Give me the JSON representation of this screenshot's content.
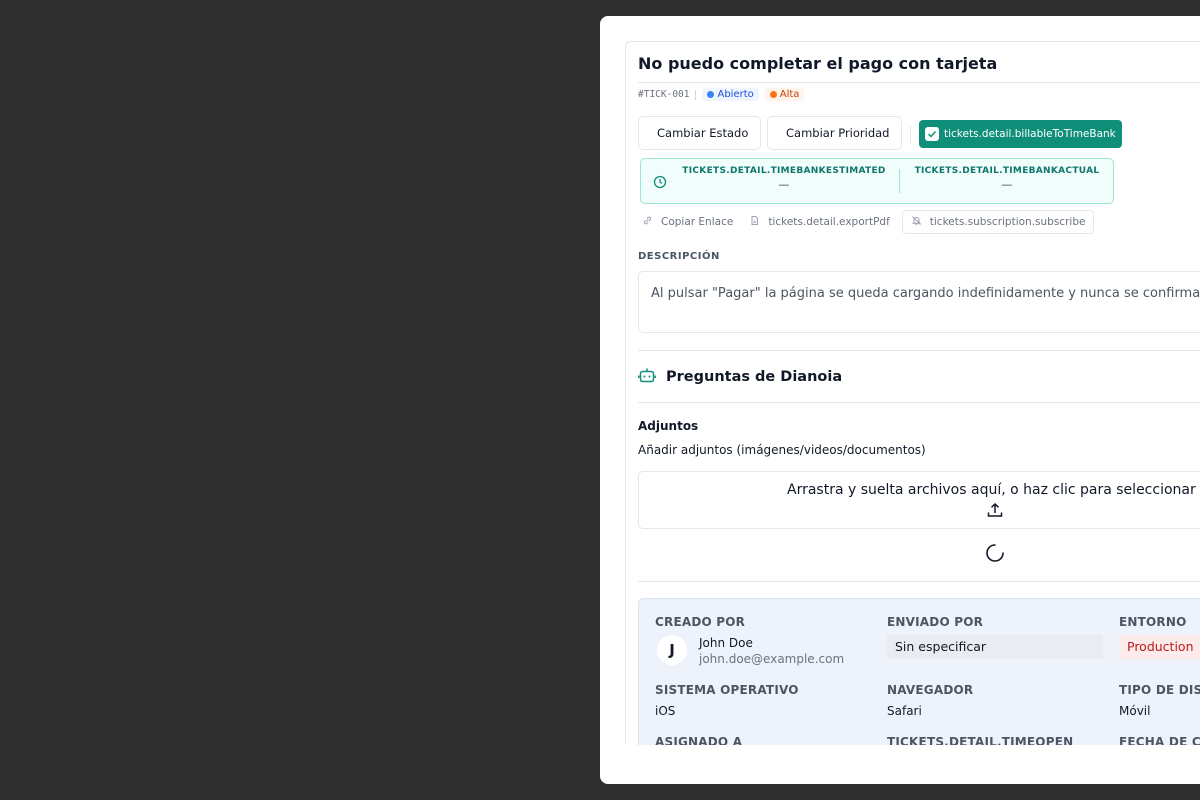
{
  "ticket": {
    "title": "No puedo completar el pago con tarjeta",
    "id": "#TICK-001",
    "status": "Abierto",
    "priority": "Alta"
  },
  "colors": {
    "status_dot": "#3b82f6",
    "priority_dot": "#f97316",
    "accent": "#0f8f7a",
    "state_dot": "#14b8a6",
    "priority_button_dot": "#f59e0b"
  },
  "actions": {
    "change_status": "Cambiar Estado",
    "change_priority": "Cambiar Prioridad",
    "billable": "tickets.detail.billableToTimeBank"
  },
  "timebank": {
    "estimated_label": "TICKETS.DETAIL.TIMEBANKESTIMATED",
    "estimated_value": "—",
    "actual_label": "TICKETS.DETAIL.TIMEBANKACTUAL",
    "actual_value": "—"
  },
  "links": {
    "copy": "Copiar Enlace",
    "export": "tickets.detail.exportPdf",
    "subscribe": "tickets.subscription.subscribe"
  },
  "description": {
    "label": "DESCRIPCIÓN",
    "text": "Al pulsar \"Pagar\" la página se queda cargando indefinidamente y nunca se confirma el pago."
  },
  "dianoia": {
    "title": "Preguntas de Dianoia"
  },
  "attachments": {
    "title": "Adjuntos",
    "subtitle": "Añadir adjuntos (imágenes/videos/documentos)",
    "dropzone": "Arrastra y suelta archivos aquí, o haz clic para seleccionar archivos"
  },
  "info": {
    "created_by_label": "CREADO POR",
    "creator_initial": "J",
    "creator_name": "John Doe",
    "creator_email": "john.doe@example.com",
    "sent_by_label": "ENVIADO POR",
    "sent_by_value": "Sin especificar",
    "environment_label": "ENTORNO",
    "environment_value": "Production",
    "os_label": "SISTEMA OPERATIVO",
    "os_value": "iOS",
    "browser_label": "NAVEGADOR",
    "browser_value": "Safari",
    "device_label": "TIPO DE DISPOSITIVO",
    "device_value": "Móvil",
    "assigned_label": "ASIGNADO A",
    "timeopen_label": "TICKETS.DETAIL.TIMEOPEN",
    "created_date_label": "FECHA DE CREACIÓN"
  }
}
